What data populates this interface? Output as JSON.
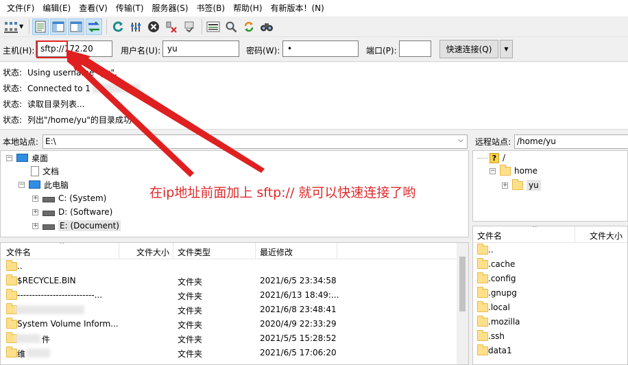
{
  "menu": [
    "文件(F)",
    "编辑(E)",
    "查看(V)",
    "传输(T)",
    "服务器(S)",
    "书签(B)",
    "帮助(H)",
    "有新版本！(N)"
  ],
  "toolbar": {
    "icons": [
      "site-manager-icon",
      "toggle-log-icon",
      "toggle-local-tree-icon",
      "toggle-remote-tree-icon",
      "toggle-queue-icon",
      "refresh-icon",
      "process-queue-icon",
      "cancel-icon",
      "disconnect-icon",
      "reconnect-icon",
      "filter-icon",
      "compare-icon",
      "sync-browse-icon",
      "search-icon"
    ]
  },
  "quickconnect": {
    "host_label": "主机(H):",
    "host_value": "sftp://172.20",
    "user_label": "用户名(U):",
    "user_value": "yu",
    "pass_label": "密码(W):",
    "pass_value": "•",
    "port_label": "端口(P):",
    "port_value": "",
    "connect_button": "快速连接(Q)",
    "dropdown_icon": "chevron-down-icon"
  },
  "log": [
    {
      "key": "状态:",
      "text": "Using username \"yu\"."
    },
    {
      "key": "状态:",
      "text": "Connected to 1"
    },
    {
      "key": "状态:",
      "text": "读取目录列表..."
    },
    {
      "key": "状态:",
      "text": "列出\"/home/yu\"的目录成功"
    }
  ],
  "local": {
    "site_label": "本地站点:",
    "site_path": "E:\\",
    "tree": [
      {
        "label": "桌面",
        "icon": "desktop-icon"
      },
      {
        "label": "文档",
        "icon": "document-icon"
      },
      {
        "label": "此电脑",
        "icon": "computer-icon"
      },
      {
        "label": "C: (System)",
        "icon": "drive-icon"
      },
      {
        "label": "D: (Software)",
        "icon": "drive-icon"
      },
      {
        "label": "E: (Document)",
        "icon": "drive-icon"
      }
    ],
    "columns": [
      "文件名",
      "文件大小",
      "文件类型",
      "最近修改"
    ],
    "rows": [
      {
        "name": "..",
        "type": "",
        "modified": ""
      },
      {
        "name": "$RECYCLE.BIN",
        "type": "文件夹",
        "modified": "2021/6/5 23:34:58"
      },
      {
        "name": "--------------------------...",
        "type": "文件夹",
        "modified": "2021/6/13 18:49:..."
      },
      {
        "name": "",
        "type": "文件夹",
        "modified": "2021/6/8 23:48:41"
      },
      {
        "name": "System Volume Inform...",
        "type": "文件夹",
        "modified": "2020/4/9 22:33:29"
      },
      {
        "name": "件",
        "type": "文件夹",
        "modified": "2021/5/5 15:28:52"
      },
      {
        "name": "维",
        "type": "文件夹",
        "modified": "2021/6/5 17:06:20"
      }
    ]
  },
  "remote": {
    "site_label": "远程站点:",
    "site_path": "/home/yu",
    "tree": [
      {
        "label": "/",
        "icon": "unknown-folder-icon"
      },
      {
        "label": "home",
        "icon": "folder-icon"
      },
      {
        "label": "yu",
        "icon": "folder-icon"
      }
    ],
    "columns": [
      "文件名",
      "文件大小"
    ],
    "rows": [
      "..",
      ".cache",
      ".config",
      ".gnupg",
      ".local",
      ".mozilla",
      ".ssh",
      "data1"
    ]
  },
  "annotation": "在ip地址前面加上 sftp:// 就可以快速连接了哟",
  "colors": {
    "annotation": "#e0292a",
    "selection": "#cce4f7"
  }
}
